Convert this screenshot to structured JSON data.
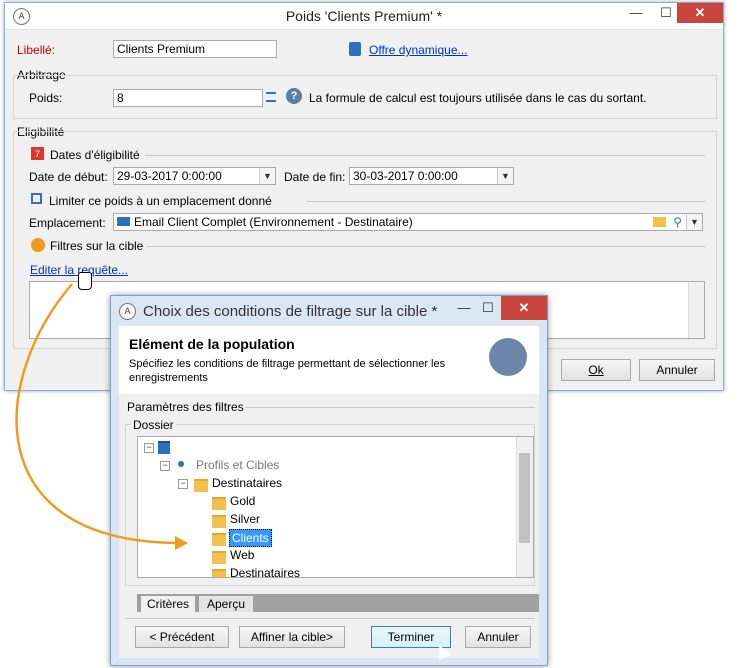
{
  "main": {
    "title": "Poids 'Clients Premium' *",
    "libelle_label": "Libellé:",
    "libelle_value": "Clients Premium",
    "offre_link": "Offre dynamique...",
    "arbitrage_title": "Arbitrage",
    "poids_label": "Poids:",
    "poids_value": "8",
    "poids_help": "La formule de calcul est toujours utilisée dans le cas du sortant.",
    "eligibilite_title": "Eligibilité",
    "dates_title": "Dates d'éligibilité",
    "date_debut_label": "Date de début:",
    "date_debut_value": "29-03-2017 0:00:00",
    "date_fin_label": "Date de fin:",
    "date_fin_value": "30-03-2017 0:00:00",
    "limit_label": "Limiter ce poids à un emplacement donné",
    "emplacement_label": "Emplacement:",
    "emplacement_value": "Email Client Complet (Environnement - Destinataire)",
    "filtres_title": "Filtres sur la cible",
    "edit_link": "Editer la requête...",
    "ok_label": "Ok",
    "annuler_label": "Annuler"
  },
  "dialog": {
    "title": "Choix des conditions de filtrage sur la cible *",
    "heading": "Elément de la population",
    "description": "Spécifiez les conditions de filtrage permettant de sélectionner les enregistrements",
    "params_title": "Paramètres des filtres",
    "dossier_title": "Dossier",
    "tree": [
      "",
      "Profils et Cibles",
      "Destinataires",
      "Gold",
      "Silver",
      "Clients",
      "Web",
      "Destinataires"
    ],
    "tab_criteres": "Critères",
    "tab_apercu": "Aperçu",
    "btn_prev": "< Précédent",
    "btn_affiner": "Affiner la cible>",
    "btn_terminer": "Terminer",
    "btn_annuler": "Annuler"
  },
  "colors": {
    "accent": "#0033cc",
    "required": "#c00000",
    "selection": "#3399ff",
    "arrow": "#f29a1f"
  }
}
